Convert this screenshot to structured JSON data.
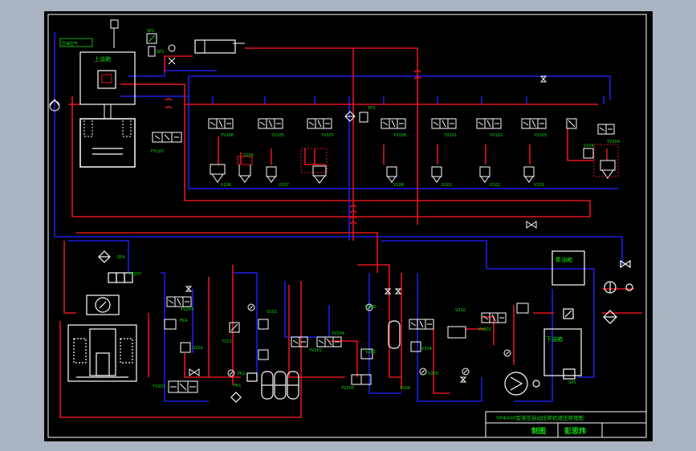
{
  "window": {
    "background": "#a9b3c1",
    "canvas_color": "#000000"
  },
  "colors": {
    "red": "#e1141e",
    "blue": "#1e1ee6",
    "white": "#ffffff",
    "green": "#14dc14",
    "gray": "#bcbcbc"
  },
  "labels": {
    "air_source": "压缩空气",
    "upper_tank": "上油箱",
    "drain_tank": "集油箱",
    "lower_tank": "下油箱",
    "fv103": "FV103",
    "yv106": "YV106",
    "yv105": "YV105",
    "yv107": "YV107",
    "yv108": "YV108",
    "yv101": "YV101",
    "yv102": "YV102",
    "yv103": "YV103",
    "yv104": "YV104",
    "v106": "V106",
    "v105": "V105",
    "v107": "V107",
    "v108": "V108",
    "v101": "V101",
    "v102": "V102",
    "v103": "V103",
    "v104": "V104",
    "sp1": "SP1",
    "sp2": "SP2",
    "sp3": "SP3",
    "sp4": "SP4",
    "sp5": "SP5",
    "yv207": "YV207",
    "yv203": "YV203",
    "yv201": "YV201",
    "yv202": "YV202",
    "yv204": "YV204",
    "yv205": "YV205",
    "yv301": "YV301",
    "v201": "V201",
    "v202": "V202",
    "v203": "V203",
    "v204": "V204",
    "v205": "V205",
    "v206": "V206",
    "v209": "V209",
    "v210": "V210",
    "fk4": "FK4",
    "pk1": "PK1",
    "y213": "Y213",
    "pk2": "PK2"
  },
  "title_block": {
    "title": "YP4000型液压自动压砖机液压原理图",
    "drawn_label": "制图",
    "author": "彭思炜"
  }
}
